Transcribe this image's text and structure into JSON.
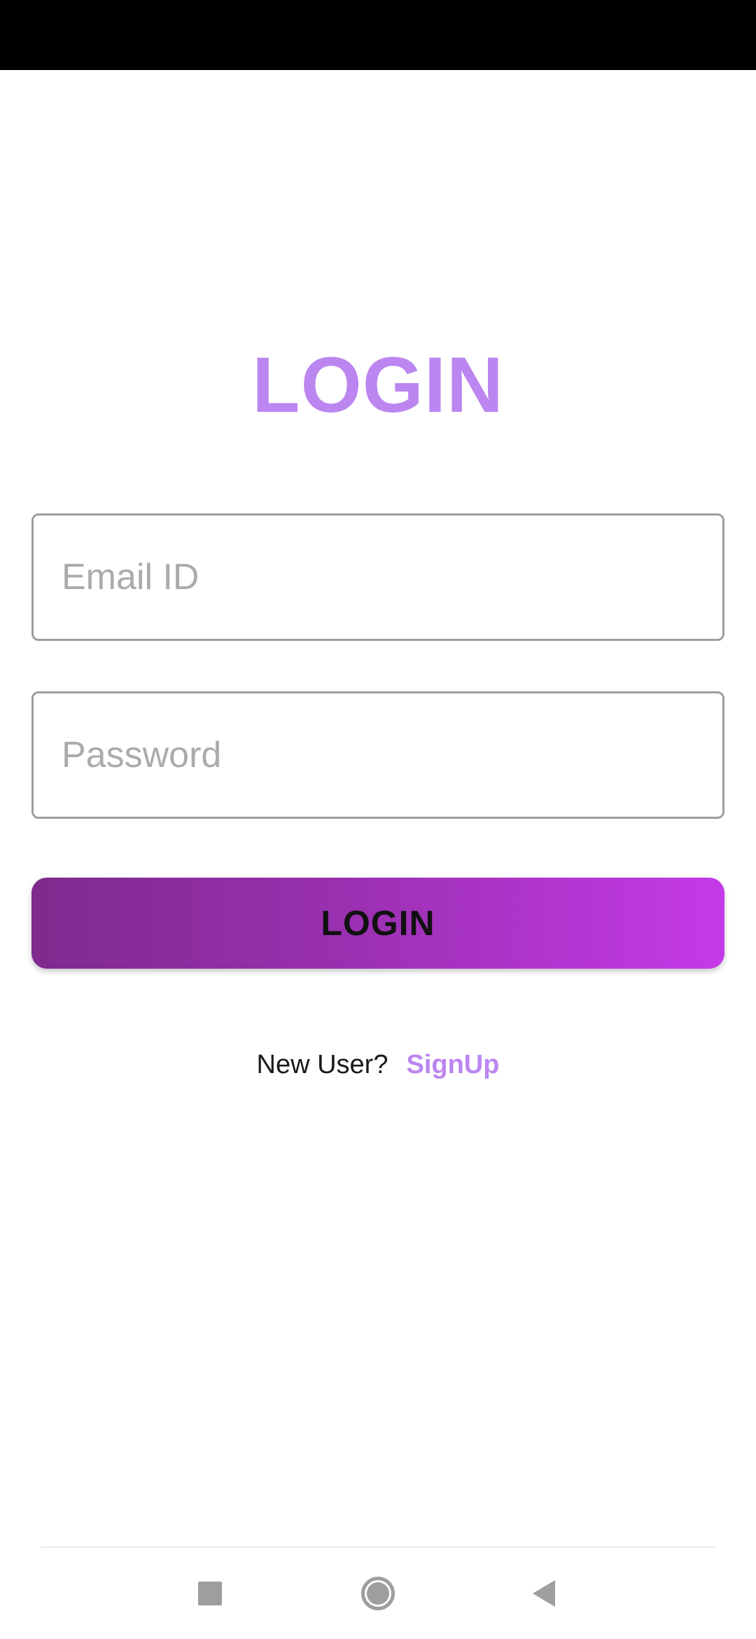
{
  "screen": {
    "title": "LOGIN"
  },
  "form": {
    "email": {
      "placeholder": "Email ID",
      "value": ""
    },
    "password": {
      "placeholder": "Password",
      "value": ""
    },
    "submit_label": "LOGIN"
  },
  "signup": {
    "prompt": "New User?",
    "link_label": "SignUp"
  },
  "navigation_bar": {
    "buttons": [
      "recents-icon",
      "home-icon",
      "back-icon"
    ]
  },
  "colors": {
    "accent": "#bb86f0",
    "button_gradient_start": "#7f2a8e",
    "button_gradient_end": "#c53ae8",
    "field_border": "#9e9e9e",
    "placeholder": "#ababab",
    "status_bar": "#000000"
  }
}
